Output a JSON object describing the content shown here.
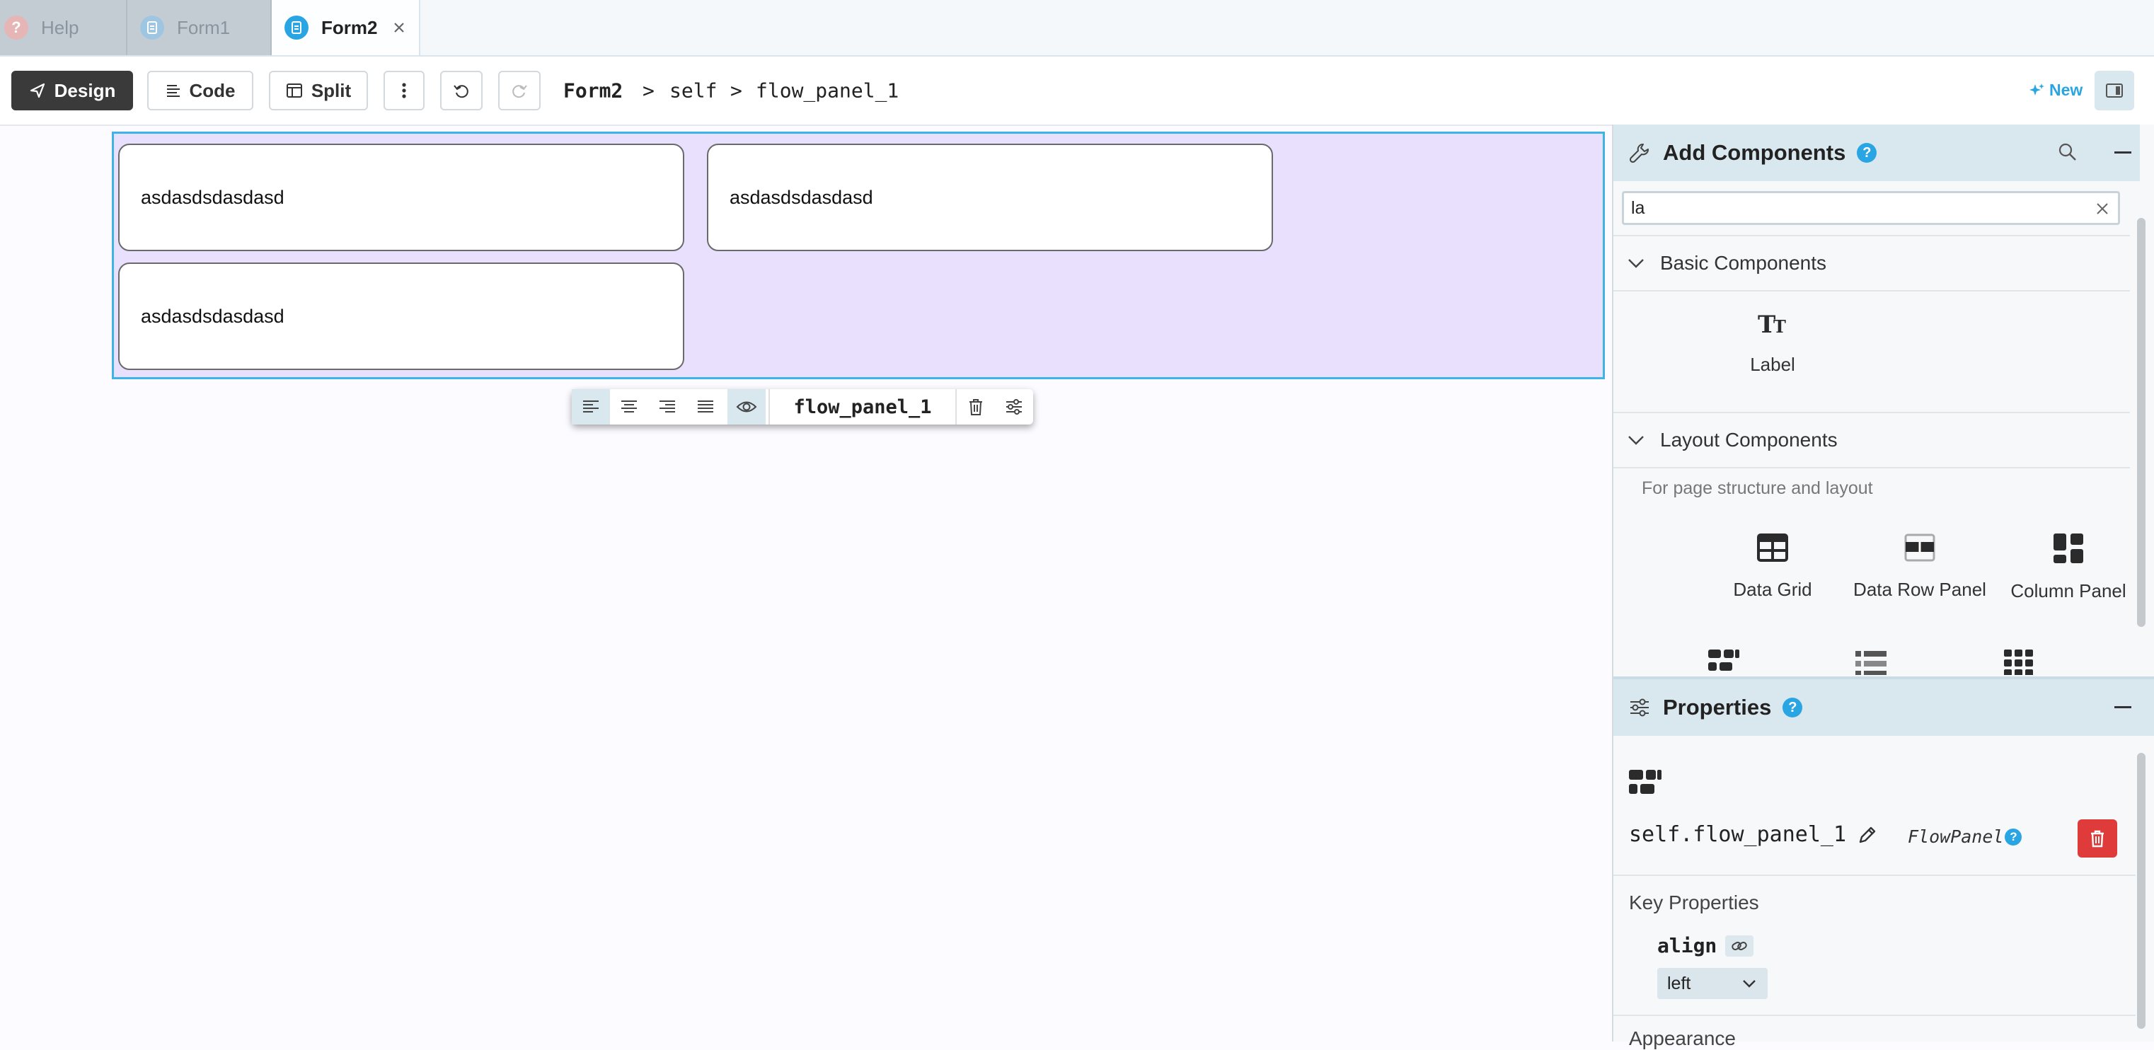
{
  "tabs": [
    {
      "label": "Help",
      "state": "inactive"
    },
    {
      "label": "Form1",
      "state": "inactive"
    },
    {
      "label": "Form2",
      "state": "active"
    }
  ],
  "toolbar": {
    "design_label": "Design",
    "code_label": "Code",
    "split_label": "Split",
    "new_label": "New"
  },
  "breadcrumb": {
    "form": "Form2",
    "sep1": ">",
    "self": "self",
    "sep2": ">",
    "component": "flow_panel_1"
  },
  "canvas": {
    "textboxes": [
      "asdasdsdasdasd",
      "asdasdsdasdasd",
      "asdasdsdasdasd"
    ],
    "floating_toolbar": {
      "component_name": "flow_panel_1"
    }
  },
  "add_components": {
    "title": "Add Components",
    "help": "?",
    "search_value": "la",
    "sections": [
      {
        "title": "Basic Components",
        "items": [
          "Label"
        ]
      },
      {
        "title": "Layout Components",
        "description": "For page structure and layout",
        "items": [
          "Data Grid",
          "Data Row Panel",
          "Column Panel"
        ]
      }
    ]
  },
  "properties": {
    "title": "Properties",
    "help": "?",
    "component_path": "self.flow_panel_1",
    "component_type": "FlowPanel",
    "type_help": "?",
    "key_properties_label": "Key Properties",
    "align_label": "align",
    "align_value": "left",
    "next_section_label": "Appearance"
  },
  "colors": {
    "accent": "#2aa5e3",
    "design_button": "#3a3a3a",
    "selection_border": "#3fb3e5",
    "flow_panel_bg": "#e8e0fd",
    "delete_button": "#e03b3b",
    "panel_header": "#d9e7ee"
  }
}
